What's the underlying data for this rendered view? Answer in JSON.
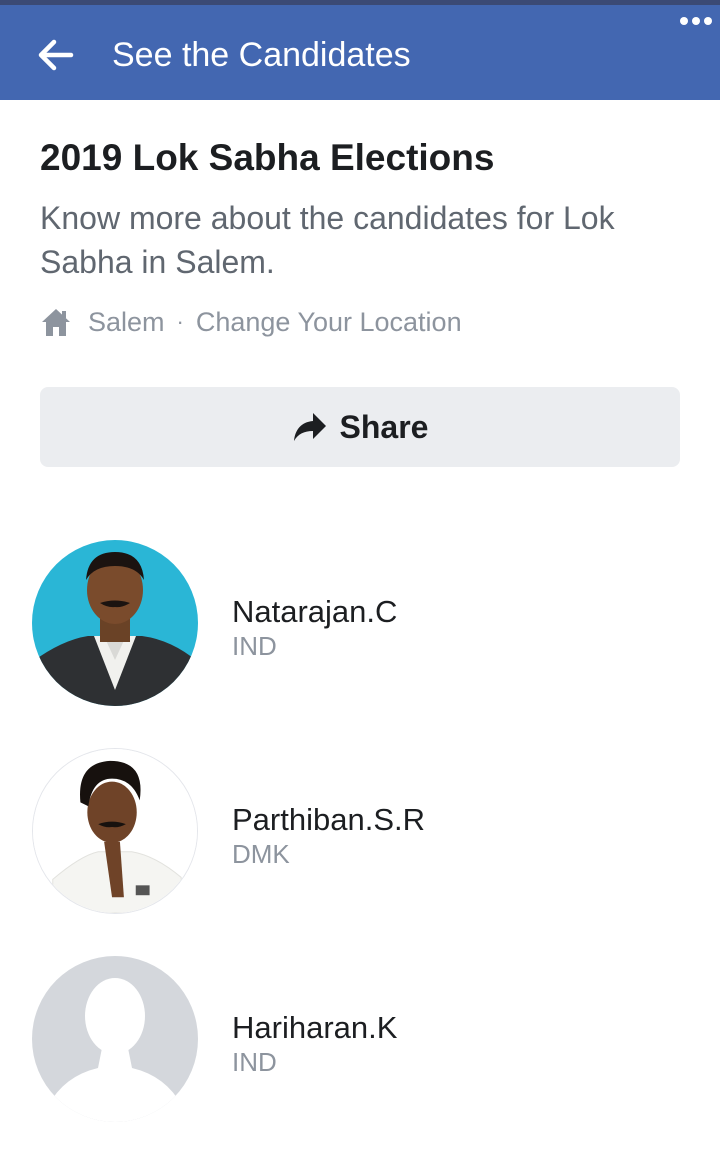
{
  "appbar": {
    "title": "See the Candidates",
    "back_icon": "arrow-left-icon",
    "more_icon": "more-horizontal-icon",
    "color": "#4367b1"
  },
  "election": {
    "heading": "2019 Lok Sabha Elections",
    "subtitle": "Know more about the candidates for Lok Sabha in Salem.",
    "location": "Salem",
    "separator": "·",
    "change_location": "Change Your Location"
  },
  "share": {
    "label": "Share",
    "icon": "share-arrow-icon"
  },
  "candidates": [
    {
      "name": "Natarajan.C",
      "party": "IND",
      "avatar": "candidate-photo"
    },
    {
      "name": "Parthiban.S.R",
      "party": "DMK",
      "avatar": "candidate-photo"
    },
    {
      "name": "Hariharan.K",
      "party": "IND",
      "avatar": "default-profile-silhouette"
    }
  ]
}
